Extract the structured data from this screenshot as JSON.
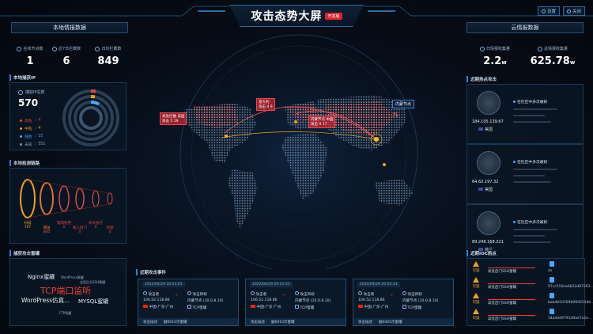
{
  "header": {
    "title": "攻击态势大屏",
    "badge": "开发版",
    "btn_settings": "设置",
    "btn_close": "关闭"
  },
  "left": {
    "panel_title": "本地情报数据",
    "stats": [
      {
        "label": "在线节点数",
        "value": "1"
      },
      {
        "label": "近7日拦截数",
        "value": "6"
      },
      {
        "label": "日均拦截数",
        "value": "849"
      }
    ],
    "attack_ip": {
      "section": "本地捕获IP",
      "label": "捕获IP总数",
      "total": "570",
      "legend": [
        {
          "name": "高危",
          "value": "4",
          "color": "#e8423a"
        },
        {
          "name": "中危",
          "value": "4",
          "color": "#f0a020"
        },
        {
          "name": "低危",
          "value": "15",
          "color": "#4aa8ff"
        },
        {
          "name": "未知",
          "value": "551",
          "color": "#7f8fa0"
        }
      ]
    },
    "funnel": {
      "section": "本地检测链路",
      "steps": [
        {
          "name": "扫描",
          "value": "767",
          "color": "#f0a020"
        },
        {
          "name": "爆破",
          "value": "845",
          "color": "#e07030"
        },
        {
          "name": "漏洞利用",
          "value": "0",
          "color": "#d84a4a"
        },
        {
          "name": "植入后门",
          "value": "0",
          "color": "#d84a4a"
        },
        {
          "name": "命令执行",
          "value": "0",
          "color": "#d84a4a"
        },
        {
          "name": "外联",
          "value": "0",
          "color": "#d84a4a"
        }
      ]
    },
    "cloud_words": {
      "section": "捕获攻击蜜罐",
      "words": [
        {
          "text": "Nginx蜜罐",
          "size": 7,
          "color": "#e6eef6"
        },
        {
          "text": "WordPress蜜罐",
          "size": 4,
          "color": "#8fa9c0"
        },
        {
          "text": "宝塔后台SSH蜜罐",
          "size": 4,
          "color": "#8fa9c0"
        },
        {
          "text": "TCP端口监听",
          "size": 11,
          "color": "#e8423a"
        },
        {
          "text": "WordPress仿真...",
          "size": 7.5,
          "color": "#e6eef6"
        },
        {
          "text": "MYSQL蜜罐",
          "size": 7,
          "color": "#e6eef6"
        },
        {
          "text": "FTP蜜罐",
          "size": 4,
          "color": "#8fa9c0"
        }
      ]
    }
  },
  "right": {
    "panel_title": "云情报数据",
    "stats": [
      {
        "label": "日情报收集量",
        "value": "2.2",
        "unit": "w"
      },
      {
        "label": "总情报收集量",
        "value": "625.78",
        "unit": "w"
      }
    ],
    "cloud_section": "近期热点攻击",
    "cloud_items": [
      {
        "ip": "184.105.139.67",
        "country": "美国",
        "tag": "在社区中多次被标"
      },
      {
        "ip": "64.62.197.32",
        "country": "美国",
        "tag": "在社区中多次被标"
      },
      {
        "ip": "89.248.168.221",
        "country": "荷兰",
        "tag": "在社区中多次被标"
      }
    ],
    "ioc_section": "近期IOC热点",
    "ioc_rows": [
      {
        "level": "可疑",
        "tag": "高危后门SSH蜜罐",
        "hash": "sh"
      },
      {
        "level": "可疑",
        "tag": "高危后门SSH蜜罐",
        "hash": "97cc510ea0b52d87283..."
      },
      {
        "level": "可疑",
        "tag": "高危后门SSH蜜罐",
        "hash": "bab4b5d769b09d5544b..."
      },
      {
        "level": "可疑",
        "tag": "高危后门SSH蜜罐",
        "hash": "34ad4d9791d9ae7a2e..."
      }
    ]
  },
  "map": {
    "labels": [
      {
        "country": "美国",
        "label": "高危拦截",
        "v1": "攻击",
        "v2": "5",
        "v3": "19"
      },
      {
        "country": "意大利",
        "label": "",
        "v1": "攻击",
        "v2": "4",
        "v3": "9"
      },
      {
        "country": "中国",
        "label": "内蒙节点",
        "v1": "攻击",
        "v2": "9",
        "v3": "17"
      }
    ],
    "node": "内蒙节点",
    "count": "7L"
  },
  "events": {
    "section": "近期攻击事件",
    "items": [
      {
        "time": "2022/04/29 20:53:01",
        "attacker": "攻击者",
        "src_ip": "106.52.118.86",
        "src_loc": "中国-广东-广州",
        "target_label": "攻击目标",
        "target": "内蒙节点 (10.0.8.10)",
        "target_type": "TCP蜜罐",
        "foot1": "攻击描述",
        "foot2": "触6010示蜜罐"
      },
      {
        "time": "2022/04/29 20:53:33",
        "attacker": "攻击者",
        "src_ip": "106.52.118.86",
        "src_loc": "中国-广东-广州",
        "target_label": "攻击目标",
        "target": "内蒙节点 (10.0.8.10)",
        "target_type": "TCP蜜罐",
        "foot1": "攻击描述",
        "foot2": "触6010示蜜罐"
      },
      {
        "time": "2022/04/29 20:53:33",
        "attacker": "攻击者",
        "src_ip": "106.52.118.86",
        "src_loc": "中国-广东-广州",
        "target_label": "攻击目标",
        "target": "内蒙节点 (10.0.8.10)",
        "target_type": "TCP蜜罐",
        "foot1": "攻击描述",
        "foot2": "触6005示蜜罐"
      }
    ]
  }
}
